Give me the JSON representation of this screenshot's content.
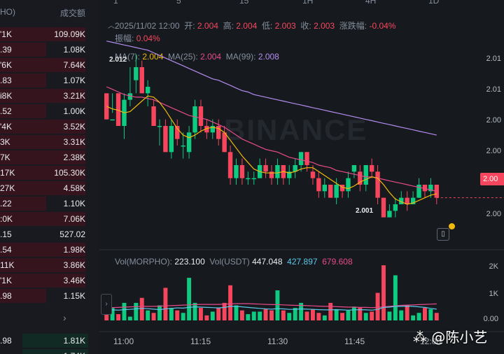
{
  "orderbook": {
    "header_left": "HO)",
    "header_right": "成交额",
    "rows": [
      {
        "left": "'1K",
        "right": "109.09K",
        "side": "ask",
        "depth": 1.0
      },
      {
        "left": ".39",
        "right": "1.08K",
        "side": "ask",
        "depth": 0.55
      },
      {
        "left": "'6K",
        "right": "7.64K",
        "side": "ask",
        "depth": 1.0
      },
      {
        "left": ".83",
        "right": "1.07K",
        "side": "ask",
        "depth": 0.55
      },
      {
        "left": "i8K",
        "right": "3.21K",
        "side": "ask",
        "depth": 1.0
      },
      {
        "left": ".52",
        "right": "1.00K",
        "side": "ask",
        "depth": 0.55
      },
      {
        "left": "'4K",
        "right": "3.52K",
        "side": "ask",
        "depth": 1.0
      },
      {
        "left": "3K",
        "right": "3.31K",
        "side": "ask",
        "depth": 1.0
      },
      {
        "left": "7K",
        "right": "2.38K",
        "side": "ask",
        "depth": 1.0
      },
      {
        "left": "17K",
        "right": "105.30K",
        "side": "ask",
        "depth": 1.0
      },
      {
        "left": "27K",
        "right": "4.58K",
        "side": "ask",
        "depth": 1.0
      },
      {
        "left": ".22",
        "right": "1.10K",
        "side": "ask",
        "depth": 0.55
      },
      {
        "left": ":0K",
        "right": "7.06K",
        "side": "ask",
        "depth": 1.0
      },
      {
        "left": ".15",
        "right": "527.02",
        "side": "ask",
        "depth": 0.0
      },
      {
        "left": ".54",
        "right": "1.98K",
        "side": "ask",
        "depth": 1.0
      },
      {
        "left": "11K",
        "right": "3.86K",
        "side": "ask",
        "depth": 1.0
      },
      {
        "left": "'1K",
        "right": "3.46K",
        "side": "ask",
        "depth": 1.0
      },
      {
        "left": ".98",
        "right": "1.15K",
        "side": "ask",
        "depth": 0.5
      }
    ],
    "spread_chevron": "›",
    "bid_rows": [
      {
        "left": ".98",
        "right": "1.81K",
        "side": "bid",
        "depth": 0.75
      },
      {
        "left": "",
        "right": "1.74K",
        "side": "bid",
        "depth": 0.75
      }
    ]
  },
  "chart": {
    "top_bar": [
      "1",
      "5",
      "15",
      "1H",
      "4H",
      "1D"
    ],
    "info": {
      "datetime": "2025/11/02 12:00",
      "open_label": "开:",
      "open": "2.004",
      "high_label": "高:",
      "high": "2.004",
      "low_label": "低:",
      "low": "2.003",
      "close_label": "收:",
      "close": "2.003",
      "change_label": "涨跌幅:",
      "change": "-0.04%",
      "amplitude_label": "振幅:",
      "amplitude": "0.04%"
    },
    "ma": {
      "ma7_label": "MA(7):",
      "ma7": "2.004",
      "ma25_label": "MA(25):",
      "ma25": "2.004",
      "ma99_label": "MA(99):",
      "ma99": "2.008"
    },
    "watermark": "BINANCE",
    "high_marker": "2.012",
    "low_marker": "2.001",
    "price_tag": "2.00",
    "y_ticks": [
      "2.01",
      "2.01",
      "2.00",
      "2.00",
      "2.00",
      "2.00"
    ],
    "volume": {
      "vol_label": "Vol(MORPHO):",
      "vol_value": "223.100",
      "usdt_label": "Vol(USDT)",
      "usdt_value": "447.048",
      "ma_value_1": "427.897",
      "ma_value_2": "679.608",
      "ticks": [
        "2K",
        "1K",
        "0.00"
      ]
    },
    "x_ticks": [
      "11:00",
      "11:15",
      "11:30",
      "11:45",
      "12:00"
    ],
    "colors": {
      "up": "#0ecb81",
      "down": "#f6465d",
      "ma7": "#f0b90b",
      "ma25": "#e84a8c",
      "ma99": "#b48cf0",
      "vol_ma1": "#5bc8e8",
      "vol_ma2": "#e84a8c"
    }
  },
  "chart_data": {
    "type": "candlestick",
    "x_ticks": [
      "11:00",
      "11:15",
      "11:30",
      "11:45",
      "12:00"
    ],
    "candles": [
      [
        2.01,
        2.008,
        2.008,
        2.01
      ],
      [
        2.008,
        2.008,
        2.0085,
        2.01
      ],
      [
        2.01,
        2.0075,
        2.0075,
        2.01
      ],
      [
        2.0075,
        2.0095,
        2.0065,
        2.01
      ],
      [
        2.0095,
        2.01,
        2.009,
        2.012
      ],
      [
        2.011,
        2.012,
        2.01,
        2.013
      ],
      [
        2.012,
        2.01,
        2.01,
        2.0125
      ],
      [
        2.01,
        2.0105,
        2.009,
        2.011
      ],
      [
        2.009,
        2.0075,
        2.0075,
        2.0095
      ],
      [
        2.0075,
        2.0075,
        2.006,
        2.008
      ],
      [
        2.0075,
        2.0055,
        2.0055,
        2.008
      ],
      [
        2.0055,
        2.0075,
        2.005,
        2.008
      ],
      [
        2.0075,
        2.0065,
        2.006,
        2.008
      ],
      [
        2.006,
        2.006,
        2.005,
        2.007
      ],
      [
        2.0055,
        2.007,
        2.005,
        2.0075
      ],
      [
        2.007,
        2.009,
        2.0065,
        2.0095
      ],
      [
        2.009,
        2.0075,
        2.007,
        2.0095
      ],
      [
        2.0075,
        2.007,
        2.0065,
        2.008
      ],
      [
        2.007,
        2.0075,
        2.0065,
        2.008
      ],
      [
        2.0075,
        2.0065,
        2.006,
        2.008
      ],
      [
        2.007,
        2.0055,
        2.0055,
        2.0075
      ],
      [
        2.0055,
        2.0035,
        2.003,
        2.006
      ],
      [
        2.0035,
        2.0045,
        2.003,
        2.005
      ],
      [
        2.0045,
        2.0035,
        2.003,
        2.005
      ],
      [
        2.0035,
        2.0035,
        2.003,
        2.004
      ],
      [
        2.0035,
        2.0035,
        2.003,
        2.004
      ],
      [
        2.0035,
        2.0045,
        2.0035,
        2.005
      ],
      [
        2.0045,
        2.004,
        2.0035,
        2.005
      ],
      [
        2.004,
        2.0035,
        2.003,
        2.0045
      ],
      [
        2.0035,
        2.0045,
        2.003,
        2.005
      ],
      [
        2.0045,
        2.0035,
        2.003,
        2.0045
      ],
      [
        2.0035,
        2.004,
        2.003,
        2.0045
      ],
      [
        2.004,
        2.0045,
        2.0035,
        2.005
      ],
      [
        2.0045,
        2.0055,
        2.004,
        2.0055
      ],
      [
        2.0055,
        2.0045,
        2.004,
        2.0055
      ],
      [
        2.004,
        2.0035,
        2.003,
        2.0045
      ],
      [
        2.0035,
        2.0025,
        2.002,
        2.004
      ],
      [
        2.0025,
        2.003,
        2.002,
        2.0035
      ],
      [
        2.003,
        2.002,
        2.002,
        2.003
      ],
      [
        2.002,
        2.003,
        2.0015,
        2.0035
      ],
      [
        2.003,
        2.0025,
        2.002,
        2.003
      ],
      [
        2.0025,
        2.0035,
        2.002,
        2.004
      ],
      [
        2.004,
        2.0045,
        2.0035,
        2.0045
      ],
      [
        2.004,
        2.003,
        2.0025,
        2.0045
      ],
      [
        2.003,
        2.0045,
        2.0025,
        2.0045
      ],
      [
        2.0045,
        2.004,
        2.0035,
        2.005
      ],
      [
        2.004,
        2.002,
        2.0015,
        2.0045
      ],
      [
        2.002,
        2.0005,
        2.0005,
        2.002
      ],
      [
        2.0005,
        2.001,
        2.0005,
        2.0015
      ],
      [
        2.001,
        2.0015,
        2.0005,
        2.002
      ],
      [
        2.0015,
        2.002,
        2.0015,
        2.0025
      ],
      [
        2.002,
        2.0015,
        2.001,
        2.0025
      ],
      [
        2.0015,
        2.002,
        2.0015,
        2.0025
      ],
      [
        2.002,
        2.003,
        2.002,
        2.0035
      ],
      [
        2.003,
        2.0025,
        2.002,
        2.003
      ],
      [
        2.0025,
        2.003,
        2.002,
        2.0035
      ],
      [
        2.003,
        2.002,
        2.0015,
        2.003
      ]
    ],
    "ma7": [
      2.009,
      2.0088,
      2.0087,
      2.0085,
      2.0086,
      2.009,
      2.0094,
      2.0098,
      2.0097,
      2.0093,
      2.0087,
      2.008,
      2.0073,
      2.0068,
      2.0066,
      2.0068,
      2.0071,
      2.0073,
      2.0074,
      2.0073,
      2.007,
      2.0064,
      2.0058,
      2.0052,
      2.0047,
      2.0042,
      2.004,
      2.0039,
      2.0039,
      2.0039,
      2.004,
      2.0039,
      2.004,
      2.0042,
      2.0043,
      2.0043,
      2.004,
      2.0037,
      2.0034,
      2.0031,
      2.0028,
      2.0027,
      2.0029,
      2.0032,
      2.0034,
      2.0036,
      2.0035,
      2.003,
      2.0024,
      2.0019,
      2.0017,
      2.0015,
      2.0016,
      2.0018,
      2.002,
      2.0022,
      2.0023
    ],
    "ma25": [
      2.0105,
      2.0103,
      2.0101,
      2.0099,
      2.0098,
      2.0097,
      2.0097,
      2.0096,
      2.0095,
      2.0093,
      2.0091,
      2.0089,
      2.0087,
      2.0085,
      2.0083,
      2.0082,
      2.0081,
      2.008,
      2.0078,
      2.0076,
      2.0074,
      2.0071,
      2.0068,
      2.0065,
      2.0063,
      2.0061,
      2.0059,
      2.0057,
      2.0056,
      2.0055,
      2.0053,
      2.0051,
      2.005,
      2.0049,
      2.0048,
      2.0047,
      2.0045,
      2.0044,
      2.0043,
      2.0041,
      2.004,
      2.0039,
      2.0038,
      2.0037,
      2.0036,
      2.0036,
      2.0035,
      2.0034,
      2.0033,
      2.0032,
      2.0031,
      2.003,
      2.0029,
      2.0028,
      2.0027,
      2.0026,
      2.0025
    ],
    "ma99": [
      2.014,
      2.0139,
      2.0138,
      2.0137,
      2.0136,
      2.0135,
      2.0134,
      2.0133,
      2.0131,
      2.0129,
      2.0127,
      2.0125,
      2.0123,
      2.0121,
      2.0119,
      2.0117,
      2.0115,
      2.0113,
      2.0111,
      2.011,
      2.0108,
      2.0106,
      2.0104,
      2.0102,
      2.0101,
      2.0099,
      2.0098,
      2.0097,
      2.0096,
      2.0095,
      2.0094,
      2.0093,
      2.0092,
      2.0091,
      2.009,
      2.0089,
      2.0088,
      2.0087,
      2.0086,
      2.0085,
      2.0084,
      2.0083,
      2.0082,
      2.0081,
      2.008,
      2.0079,
      2.0078,
      2.0077,
      2.0076,
      2.0075,
      2.0074,
      2.0073,
      2.0072,
      2.0071,
      2.007,
      2.0069,
      2.0068
    ],
    "volume": [
      300,
      500,
      250,
      700,
      150,
      700,
      900,
      400,
      300,
      600,
      1300,
      500,
      400,
      300,
      1700,
      700,
      500,
      200,
      350,
      500,
      700,
      1400,
      600,
      400,
      250,
      350,
      350,
      450,
      400,
      1200,
      400,
      300,
      500,
      700,
      350,
      450,
      300,
      200,
      700,
      450,
      300,
      400,
      550,
      500,
      300,
      350,
      1100,
      2200,
      350,
      1800,
      400,
      600,
      200,
      300,
      500,
      450,
      300
    ],
    "vol_ma1": [
      400,
      420,
      410,
      430,
      440,
      460,
      480,
      470,
      450,
      430,
      460,
      480,
      500,
      490,
      520,
      540,
      530,
      520,
      510,
      500,
      520,
      560,
      560,
      540,
      520,
      500,
      480,
      460,
      450,
      470,
      460,
      440,
      440,
      460,
      450,
      440,
      430,
      420,
      420,
      430,
      420,
      410,
      420,
      430,
      420,
      410,
      440,
      520,
      530,
      560,
      560,
      570,
      560,
      540,
      520,
      480,
      450
    ],
    "vol_ma2": [
      500,
      510,
      520,
      530,
      540,
      550,
      560,
      560,
      560,
      570,
      580,
      590,
      600,
      610,
      620,
      630,
      640,
      640,
      640,
      640,
      650,
      660,
      670,
      670,
      670,
      660,
      650,
      640,
      630,
      630,
      620,
      610,
      600,
      600,
      590,
      580,
      570,
      560,
      560,
      550,
      540,
      530,
      530,
      520,
      520,
      510,
      520,
      540,
      560,
      580,
      600,
      610,
      620,
      630,
      640,
      650,
      660
    ],
    "ylim": [
      2.0,
      2.0135
    ],
    "vol_ylim": [
      0,
      2400
    ]
  }
}
